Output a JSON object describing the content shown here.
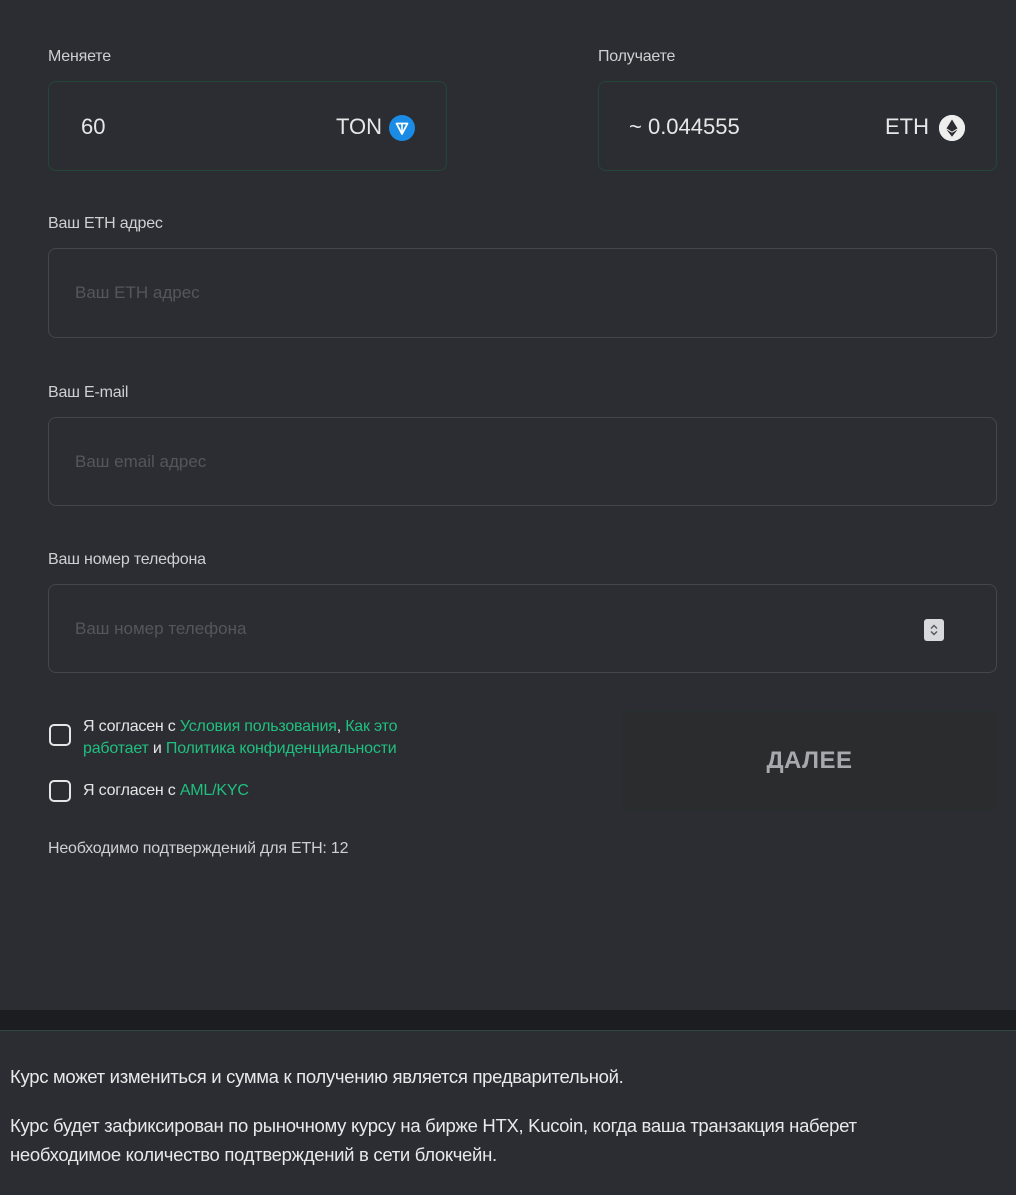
{
  "exchange": {
    "give_label": "Меняете",
    "give_amount": "60",
    "give_currency": "TON",
    "give_coin_icon": "ton-icon",
    "get_label": "Получаете",
    "get_amount": "~ 0.044555",
    "get_currency": "ETH",
    "get_coin_icon": "eth-icon"
  },
  "form": {
    "address_label": "Ваш ETH адрес",
    "address_placeholder": "Ваш ETH адрес",
    "email_label": "Ваш E-mail",
    "email_placeholder": "Ваш email адрес",
    "phone_label": "Ваш номер телефона",
    "phone_placeholder": "Ваш номер телефона"
  },
  "agreements": {
    "terms_prefix": "Я согласен с ",
    "terms_link": "Условия пользования",
    "sep_comma": ", ",
    "howto_link_1": "Как это",
    "howto_link_2": "работает",
    "and_word": " и ",
    "privacy_link": "Политика конфиденциальности",
    "aml_prefix": "Я согласен с ",
    "aml_link": "AML/KYC"
  },
  "next_button_label": "ДАЛЕЕ",
  "confirmations_text": "Необходимо подтверждений для ETH: 12",
  "notes": {
    "line1": "Курс может измениться и сумма к получению является предварительной.",
    "line2a": "Курс будет зафиксирован по рыночному курсу на бирже HTX, Kucoin, когда ваша транзакция наберет",
    "line2b": "необходимое количество подтверждений в сети блокчейн."
  },
  "colors": {
    "background": "#2c2d32",
    "accent_green": "#1fc07f",
    "ton_blue": "#1a8ce6"
  }
}
